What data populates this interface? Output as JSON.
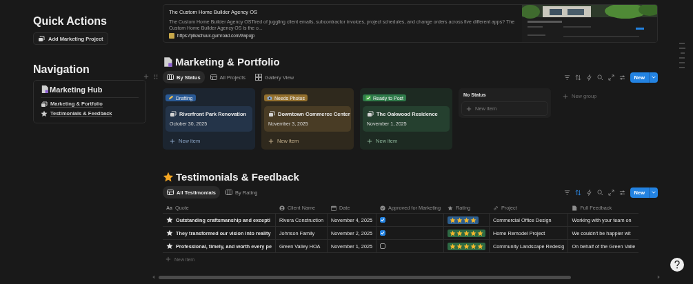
{
  "quick_actions": {
    "title": "Quick Actions",
    "button": "Add Marketing Project"
  },
  "navigation": {
    "title": "Navigation",
    "hub": "Marketing Hub",
    "links": [
      {
        "label": "Marketing & Portfolio",
        "kind": "stack"
      },
      {
        "label": "Testimonials & Feedback",
        "kind": "star"
      }
    ]
  },
  "bookmark": {
    "title": "The Custom Home Builder Agency OS",
    "description": "The Custom Home Builder Agency OSTired of juggling client emails, subcontractor invoices, project schedules, and change orders across five different apps? The Custom Home Builder Agency OS is the o...",
    "url": "https://pikachuux.gumroad.com/l/wpojp"
  },
  "board": {
    "title": "Marketing & Portfolio",
    "views": [
      {
        "label": "By Status",
        "kind": "board",
        "selected": true
      },
      {
        "label": "All Projects",
        "kind": "table",
        "selected": false
      },
      {
        "label": "Gallery View",
        "kind": "gallery",
        "selected": false
      }
    ],
    "sort_active": false,
    "new_button": "New",
    "groups": [
      {
        "label": "Drafting",
        "kind": "pencil",
        "color": "#2a5a96",
        "cards": [
          {
            "title": "Riverfront Park Renovation",
            "date": "October 30, 2025"
          }
        ],
        "new_item": "New item"
      },
      {
        "label": "Needs Photos",
        "kind": "camera",
        "color": "#94702e",
        "cards": [
          {
            "title": "Downtown Commerce Center",
            "date": "November 3, 2025"
          }
        ],
        "new_item": "New item"
      },
      {
        "label": "Ready to Post",
        "kind": "check",
        "color": "#2f7a4a",
        "cards": [
          {
            "title": "The Oakwood Residence",
            "date": "November 1, 2025"
          }
        ],
        "new_item": "New item"
      },
      {
        "label": "No Status",
        "new_item": "New item"
      }
    ],
    "new_group": "New group"
  },
  "testimonials": {
    "title": "Testimonials & Feedback",
    "views": [
      {
        "label": "All Testimonials",
        "kind": "table",
        "selected": true
      },
      {
        "label": "By Rating",
        "kind": "board",
        "selected": false
      }
    ],
    "sort_active": true,
    "new_button": "New",
    "columns": [
      {
        "label": "Quote",
        "kind": "text",
        "glyph": "Aa"
      },
      {
        "label": "Client Name",
        "kind": "person"
      },
      {
        "label": "Date",
        "kind": "date"
      },
      {
        "label": "Approved for Marketing",
        "kind": "check"
      },
      {
        "label": "Rating",
        "kind": "star"
      },
      {
        "label": "Project",
        "kind": "link"
      },
      {
        "label": "Full Feedback",
        "kind": "doc"
      }
    ],
    "rows": [
      {
        "quote": "Outstanding craftsmanship and excepti",
        "client": "Rivera Construction",
        "date": "November 4, 2025",
        "approved": true,
        "rating": {
          "stars": 4,
          "color": "#2e5f8f"
        },
        "project": "Commercial Office Design",
        "feedback": "Working with your team on"
      },
      {
        "quote": "They transformed our vision into reality",
        "client": "Johnson Family",
        "date": "November 2, 2025",
        "approved": true,
        "rating": {
          "stars": 5,
          "color": "#2e6a44"
        },
        "project": "Home Remodel Project",
        "feedback": "We couldn't be happier wit"
      },
      {
        "quote": "Professional, timely, and worth every pe",
        "client": "Green Valley HOA",
        "date": "November 1, 2025",
        "approved": false,
        "rating": {
          "stars": 5,
          "color": "#2e6a44"
        },
        "project": "Community Landscape Redesig",
        "feedback": "On behalf of the Green Valle"
      }
    ],
    "new_item": "New item"
  }
}
